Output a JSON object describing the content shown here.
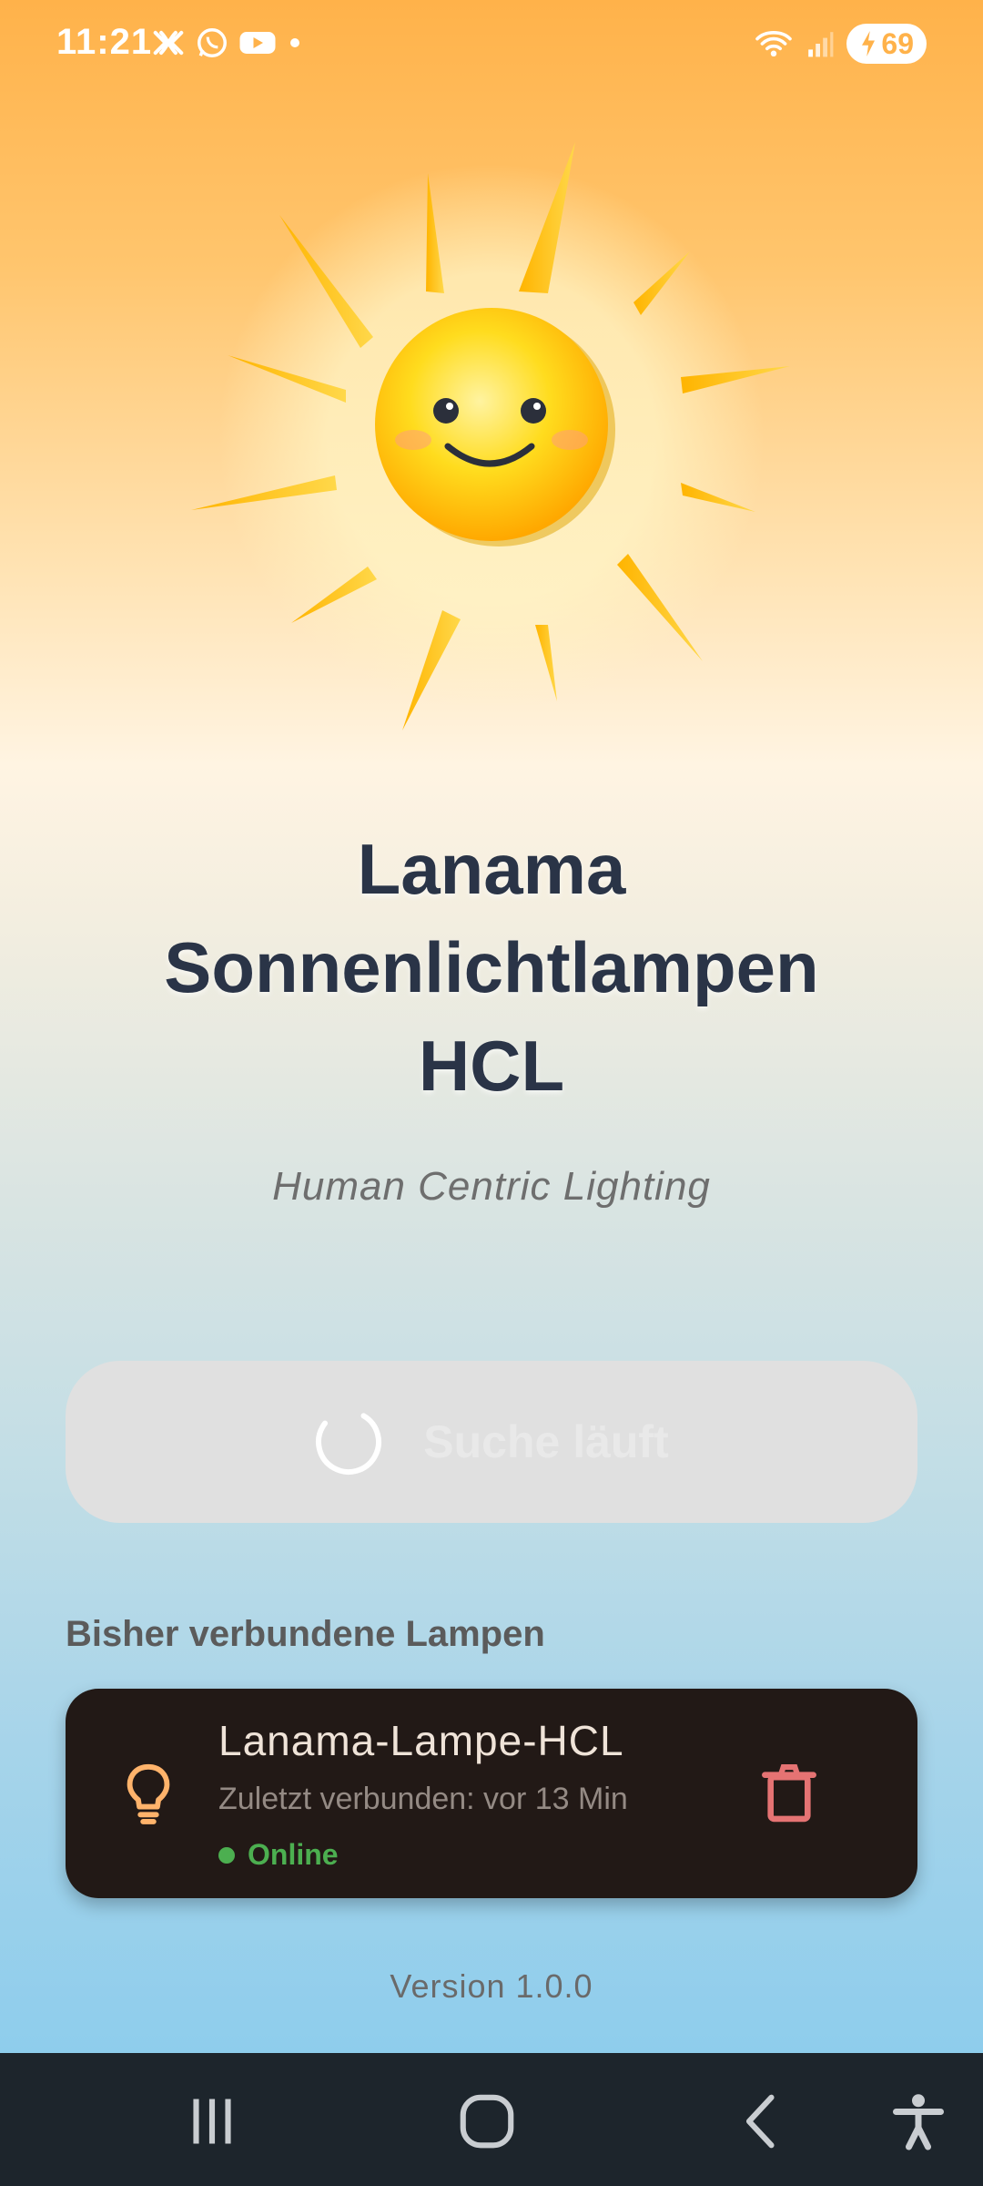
{
  "status_bar": {
    "time": "11:21",
    "left_icons": [
      "x-icon",
      "whatsapp-icon",
      "youtube-icon",
      "dot-icon"
    ],
    "battery_level": "69"
  },
  "app": {
    "title_line1": "Lanama",
    "title_line2": "Sonnenlichtlampen",
    "title_line3": "HCL",
    "subtitle": "Human Centric Lighting",
    "search_button_label": "Suche läuft",
    "section_title": "Bisher verbundene Lampen",
    "lamps": [
      {
        "name": "Lanama-Lampe-HCL",
        "last_connected": "Zuletzt verbunden: vor 13 Min",
        "status": "Online",
        "status_color": "#4caf50"
      }
    ],
    "version": "Version 1.0.0"
  },
  "colors": {
    "accent_orange": "#ffb24a",
    "card_background": "#221916",
    "delete_red": "#e57373",
    "online_green": "#4caf50"
  },
  "nav_bar": {
    "items": [
      "recents-icon",
      "home-icon",
      "back-icon",
      "accessibility-icon"
    ]
  }
}
